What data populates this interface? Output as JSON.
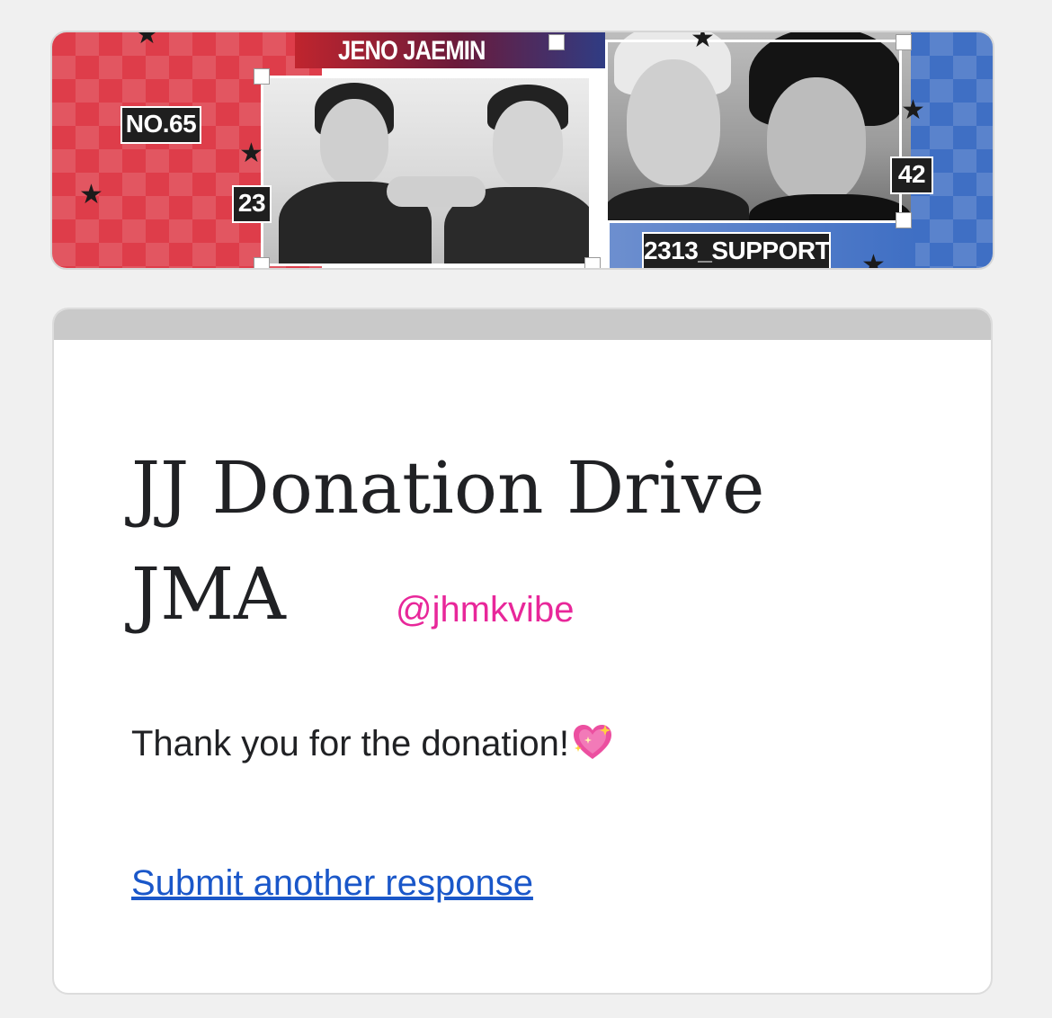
{
  "banner": {
    "title": "JENO JAEMIN",
    "number_label": "NO.65",
    "left_number": "23",
    "right_number": "42",
    "footer_label": "2313_SUPPORT",
    "colors": {
      "red": "#de3d4a",
      "blue": "#3f6fc4"
    }
  },
  "form": {
    "title_line1": "JJ Donation Drive",
    "title_line2": "JMA",
    "handle": "@jhmkvibe",
    "confirmation_message": "Thank you for the donation!",
    "confirmation_emoji": "sparkling-heart",
    "submit_another_link": "Submit another response",
    "colors": {
      "link": "#1a57c9",
      "handle": "#e8279a",
      "topbar": "#c9c9c9"
    }
  }
}
